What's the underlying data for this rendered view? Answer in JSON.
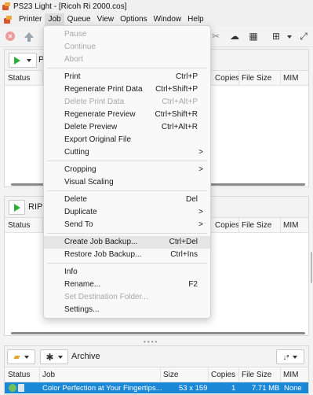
{
  "window": {
    "title": "PS23 Light - [Ricoh Ri 2000.cos]"
  },
  "menubar": {
    "items": [
      "Printer",
      "Job",
      "Queue",
      "View",
      "Options",
      "Window",
      "Help"
    ]
  },
  "toolbar": {
    "icons": [
      "cancel-icon",
      "upload-icon",
      "cloud-upload-icon",
      "grid-icon",
      "crop-icon",
      "expand-icon"
    ]
  },
  "panels": {
    "queue": {
      "title_fragment": "P",
      "columns": [
        "Status",
        "Copies",
        "File Size",
        "MIM"
      ]
    },
    "rip": {
      "title": "RIP",
      "columns": [
        "Status",
        "Copies",
        "File Size",
        "MIM"
      ]
    },
    "archive": {
      "title": "Archive",
      "columns": [
        "Status",
        "Job",
        "Size",
        "Copies",
        "File Size",
        "MIM"
      ],
      "rows": [
        {
          "job": "Color Perfection at Your Fingertips...",
          "size": "53 x 159",
          "copies": "1",
          "file_size": "7.71 MB",
          "mim": "None"
        }
      ]
    }
  },
  "job_menu": {
    "items": [
      {
        "label": "Pause",
        "shortcut": "",
        "disabled": true,
        "submenu": false
      },
      {
        "label": "Continue",
        "shortcut": "",
        "disabled": true,
        "submenu": false
      },
      {
        "label": "Abort",
        "shortcut": "",
        "disabled": true,
        "submenu": false
      },
      {
        "label": "Print",
        "shortcut": "Ctrl+P",
        "disabled": false,
        "submenu": false
      },
      {
        "label": "Regenerate Print Data",
        "shortcut": "Ctrl+Shift+P",
        "disabled": false,
        "submenu": false
      },
      {
        "label": "Delete Print Data",
        "shortcut": "Ctrl+Alt+P",
        "disabled": true,
        "submenu": false
      },
      {
        "label": "Regenerate Preview",
        "shortcut": "Ctrl+Shift+R",
        "disabled": false,
        "submenu": false
      },
      {
        "label": "Delete Preview",
        "shortcut": "Ctrl+Alt+R",
        "disabled": false,
        "submenu": false
      },
      {
        "label": "Export Original File",
        "shortcut": "",
        "disabled": false,
        "submenu": false
      },
      {
        "label": "Cutting",
        "shortcut": "",
        "disabled": false,
        "submenu": true
      },
      {
        "label": "Cropping",
        "shortcut": "",
        "disabled": false,
        "submenu": true
      },
      {
        "label": "Visual Scaling",
        "shortcut": "",
        "disabled": false,
        "submenu": false
      },
      {
        "label": "Delete",
        "shortcut": "Del",
        "disabled": false,
        "submenu": false
      },
      {
        "label": "Duplicate",
        "shortcut": "",
        "disabled": false,
        "submenu": true
      },
      {
        "label": "Send To",
        "shortcut": "",
        "disabled": false,
        "submenu": true
      },
      {
        "label": "Create Job Backup...",
        "shortcut": "Ctrl+Del",
        "disabled": false,
        "submenu": false,
        "highlighted": true
      },
      {
        "label": "Restore Job Backup...",
        "shortcut": "Ctrl+Ins",
        "disabled": false,
        "submenu": false
      },
      {
        "label": "Info",
        "shortcut": "",
        "disabled": false,
        "submenu": false
      },
      {
        "label": "Rename...",
        "shortcut": "F2",
        "disabled": false,
        "submenu": false
      },
      {
        "label": "Set Destination Folder...",
        "shortcut": "",
        "disabled": true,
        "submenu": false
      },
      {
        "label": "Settings...",
        "shortcut": "",
        "disabled": false,
        "submenu": false
      }
    ]
  },
  "colors": {
    "selection": "#1a88d6",
    "play": "#2fae3a",
    "cancel": "#ef9a9a"
  }
}
